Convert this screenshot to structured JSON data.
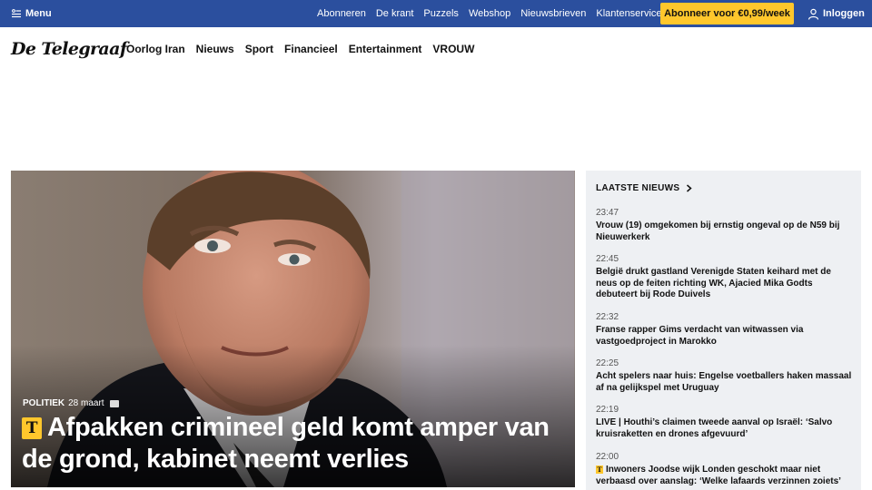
{
  "topbar": {
    "menu_label": "Menu",
    "links": [
      "Abonneren",
      "De krant",
      "Puzzels",
      "Webshop",
      "Nieuwsbrieven",
      "Klantenservice"
    ],
    "subscribe_label": "Abonneer voor €0,99/week",
    "login_label": "Inloggen"
  },
  "logo_text": "De Telegraaf",
  "nav": [
    "Oorlog Iran",
    "Nieuws",
    "Sport",
    "Financieel",
    "Entertainment",
    "VROUW"
  ],
  "hero": {
    "category": "POLITIEK",
    "date": "28 maart",
    "badge": "T",
    "title": "Afpakken crimineel geld komt amper van de grond, kabinet neemt verlies"
  },
  "sidebar": {
    "header": "LAATSTE NIEUWS",
    "items": [
      {
        "time": "23:47",
        "headline": "Vrouw (19) omgekomen bij ernstig ongeval op de N59 bij Nieuwerkerk",
        "plus": false
      },
      {
        "time": "22:45",
        "headline": "België drukt gastland Verenigde Staten keihard met de neus op de feiten richting WK, Ajacied Mika Godts debuteert bij Rode Duivels",
        "plus": false
      },
      {
        "time": "22:32",
        "headline": "Franse rapper Gims verdacht van witwassen via vastgoedproject in Marokko",
        "plus": false
      },
      {
        "time": "22:25",
        "headline": "Acht spelers naar huis: Engelse voetballers haken massaal af na gelijkspel met Uruguay",
        "plus": false
      },
      {
        "time": "22:19",
        "headline": "LIVE | Houthi’s claimen tweede aanval op Israël: ‘Salvo kruisraketten en drones afgevuurd’",
        "plus": false
      },
      {
        "time": "22:00",
        "headline": "Inwoners Joodse wijk Londen geschokt maar niet verbaasd over aanslag: ‘Welke lafaards verzinnen zoiets’",
        "plus": true,
        "plus_badge": "T"
      }
    ]
  },
  "colors": {
    "topbar": "#2b4f9e",
    "subscribe": "#ffc72c",
    "sidebar_bg": "#eef0f3"
  }
}
